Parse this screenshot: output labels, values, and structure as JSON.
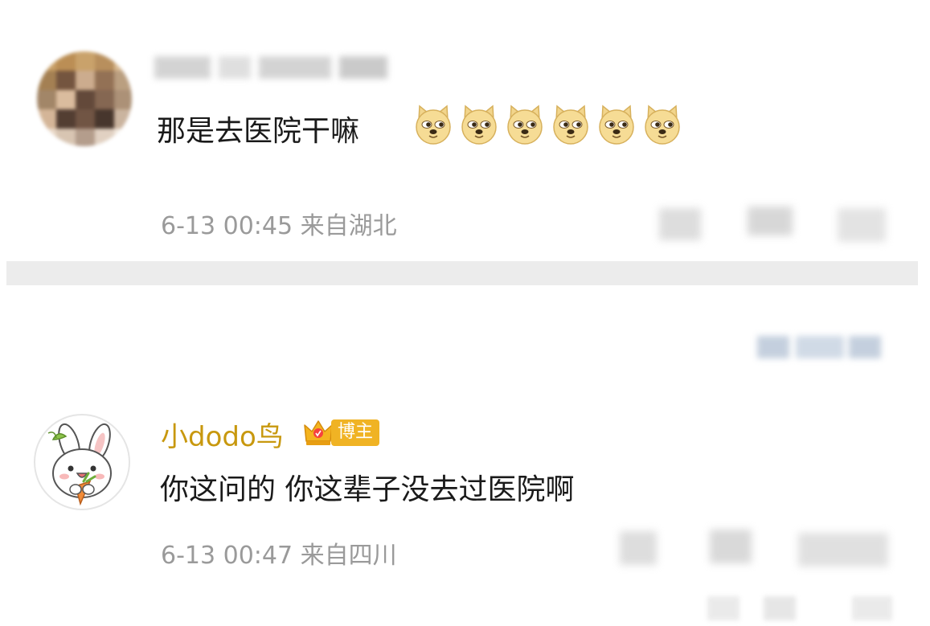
{
  "comments": [
    {
      "username": "",
      "text": "那是去医院干嘛",
      "emoji": [
        "doge-emoji",
        "doge-emoji",
        "doge-emoji",
        "doge-emoji",
        "doge-emoji",
        "doge-emoji"
      ],
      "time": "6-13 00:45",
      "location": "来自湖北",
      "meta": "6-13 00:45  来自湖北",
      "avatar": "pixelated-avatar",
      "username_blurred": true
    },
    {
      "username": "小dodo鸟",
      "badge": "博主",
      "badge_icon": "crown-icon",
      "text": "你这问的 你这辈子没去过医院啊",
      "time": "6-13 00:47",
      "location": "来自四川",
      "meta": "6-13 00:47  来自四川",
      "avatar": "bunny-avatar"
    }
  ],
  "colors": {
    "username_gold": "#c8980e",
    "badge_bg": "#f0b324",
    "meta_gray": "#9a9a9a",
    "divider": "#ececec",
    "text": "#1a1a1a"
  }
}
